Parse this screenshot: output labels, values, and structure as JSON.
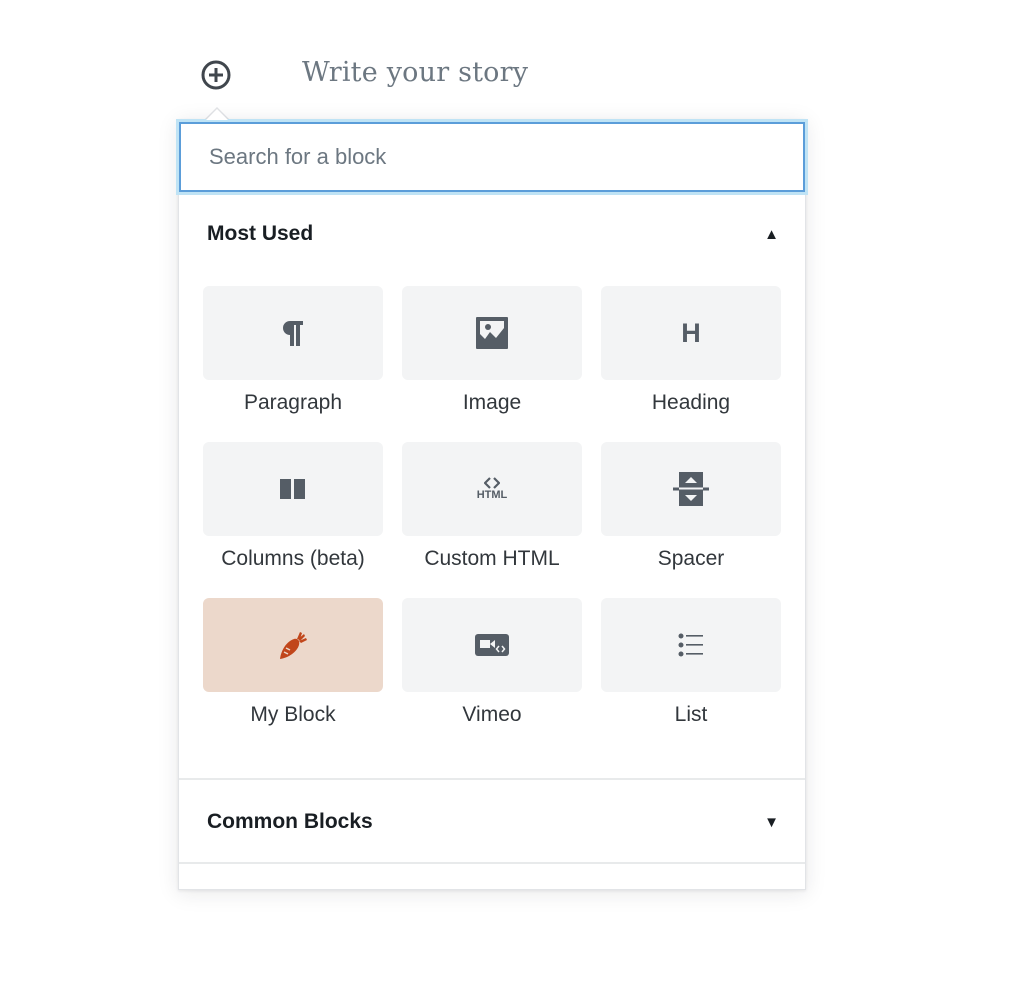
{
  "editor": {
    "title_placeholder": "Write your story",
    "inserter_toggle_icon": "plus-circle-icon"
  },
  "inserter": {
    "search": {
      "value": "",
      "placeholder": "Search for a block"
    },
    "sections": [
      {
        "title": "Most Used",
        "expanded": true,
        "toggle_icon": "caret-up-icon",
        "caret_glyph": "▲",
        "blocks": [
          {
            "label": "Paragraph",
            "icon": "paragraph-icon"
          },
          {
            "label": "Image",
            "icon": "image-icon"
          },
          {
            "label": "Heading",
            "icon": "heading-icon"
          },
          {
            "label": "Columns (beta)",
            "icon": "columns-icon"
          },
          {
            "label": "Custom HTML",
            "icon": "html-icon"
          },
          {
            "label": "Spacer",
            "icon": "spacer-icon"
          },
          {
            "label": "My Block",
            "icon": "carrot-icon",
            "highlight_color": "#ecd8cb",
            "icon_color": "#c1461b"
          },
          {
            "label": "Vimeo",
            "icon": "video-embed-icon"
          },
          {
            "label": "List",
            "icon": "list-icon"
          }
        ]
      },
      {
        "title": "Common Blocks",
        "expanded": false,
        "toggle_icon": "caret-down-icon",
        "caret_glyph": "▼"
      }
    ],
    "html_icon_text": "HTML",
    "heading_icon_text": "H"
  },
  "colors": {
    "focus_border": "#5b9dd9",
    "tile_bg": "#f3f4f5",
    "icon": "#555d66",
    "text": "#32373c"
  }
}
